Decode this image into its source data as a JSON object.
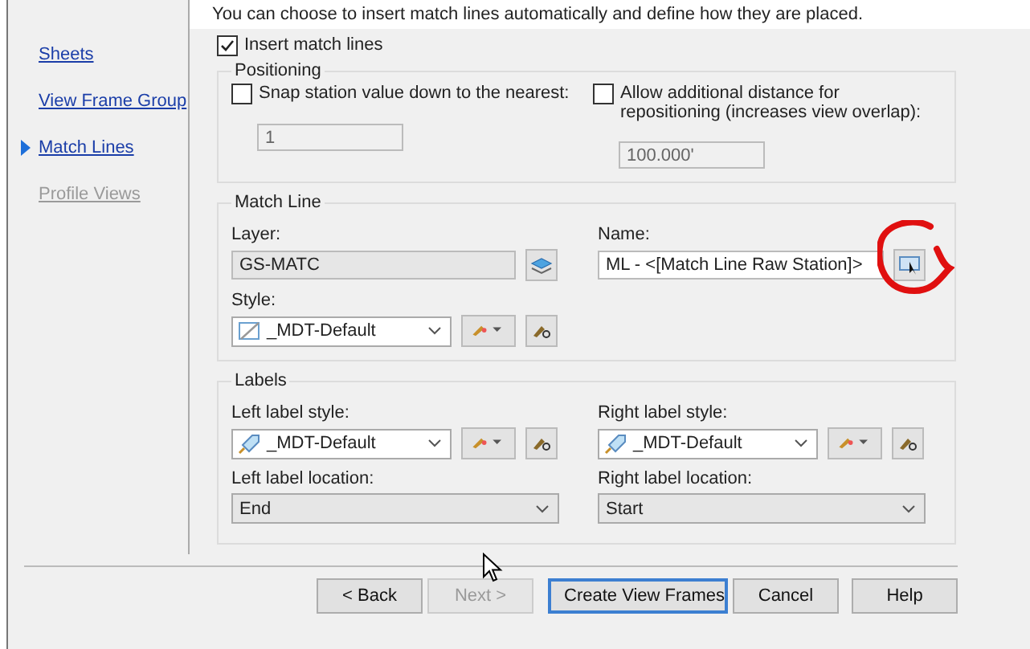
{
  "intro": "You can choose to insert match lines automatically and define how they are placed.",
  "nav": [
    {
      "label": "Sheets",
      "selected": false,
      "disabled": false
    },
    {
      "label": "View Frame Group",
      "selected": false,
      "disabled": false
    },
    {
      "label": "Match Lines",
      "selected": true,
      "disabled": false
    },
    {
      "label": "Profile Views",
      "selected": false,
      "disabled": true
    }
  ],
  "insert_match_lines": {
    "label": "Insert match lines",
    "checked": true
  },
  "positioning": {
    "title": "Positioning",
    "snap": {
      "label": "Snap station value down to the nearest:",
      "checked": false,
      "value": "1"
    },
    "allow": {
      "label": "Allow additional distance for repositioning (increases view overlap):",
      "checked": false,
      "value": "100.000'"
    }
  },
  "match_line": {
    "title": "Match Line",
    "layer_label": "Layer:",
    "layer": "GS-MATC",
    "name_label": "Name:",
    "name": "ML - <[Match Line Raw Station]>",
    "style_label": "Style:",
    "style": "_MDT-Default"
  },
  "labels": {
    "title": "Labels",
    "left_style_label": "Left label style:",
    "left_style": "_MDT-Default",
    "right_style_label": "Right label style:",
    "right_style": "_MDT-Default",
    "left_location_label": "Left label location:",
    "left_location": "End",
    "right_location_label": "Right label location:",
    "right_location": "Start"
  },
  "buttons": [
    {
      "label": "< Back",
      "disabled": false,
      "focused": false
    },
    {
      "label": "Next >",
      "disabled": true,
      "focused": false
    },
    {
      "label": "Create View Frames",
      "disabled": false,
      "focused": true
    },
    {
      "label": "Cancel",
      "disabled": false,
      "focused": false
    },
    {
      "label": "Help",
      "disabled": false,
      "focused": false
    }
  ]
}
